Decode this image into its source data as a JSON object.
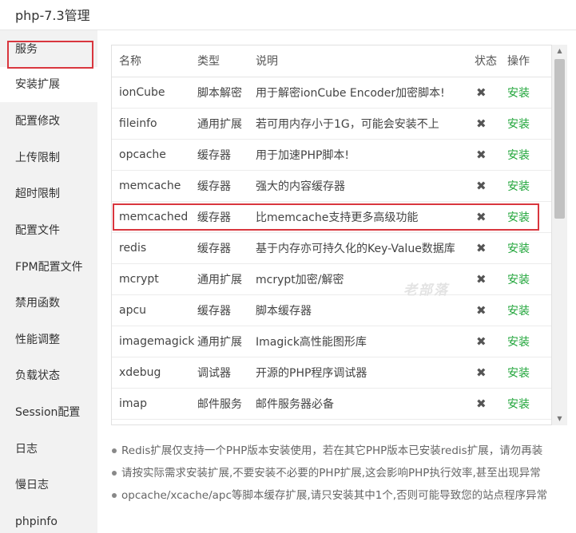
{
  "window": {
    "title": "php-7.3管理"
  },
  "sidebar": {
    "items": [
      {
        "label": "服务"
      },
      {
        "label": "安装扩展"
      },
      {
        "label": "配置修改"
      },
      {
        "label": "上传限制"
      },
      {
        "label": "超时限制"
      },
      {
        "label": "配置文件"
      },
      {
        "label": "FPM配置文件"
      },
      {
        "label": "禁用函数"
      },
      {
        "label": "性能调整"
      },
      {
        "label": "负载状态"
      },
      {
        "label": "Session配置"
      },
      {
        "label": "日志"
      },
      {
        "label": "慢日志"
      },
      {
        "label": "phpinfo"
      }
    ],
    "active_index": 1
  },
  "table": {
    "headers": {
      "name": "名称",
      "type": "类型",
      "desc": "说明",
      "status": "状态",
      "op": "操作"
    },
    "rows": [
      {
        "name": "ionCube",
        "type": "脚本解密",
        "desc": "用于解密ionCube Encoder加密脚本!",
        "status": "✖",
        "op": "安装"
      },
      {
        "name": "fileinfo",
        "type": "通用扩展",
        "desc": "若可用内存小于1G，可能会安装不上",
        "status": "✖",
        "op": "安装"
      },
      {
        "name": "opcache",
        "type": "缓存器",
        "desc": "用于加速PHP脚本!",
        "status": "✖",
        "op": "安装"
      },
      {
        "name": "memcache",
        "type": "缓存器",
        "desc": "强大的内容缓存器",
        "status": "✖",
        "op": "安装"
      },
      {
        "name": "memcached",
        "type": "缓存器",
        "desc": "比memcache支持更多高级功能",
        "status": "✖",
        "op": "安装"
      },
      {
        "name": "redis",
        "type": "缓存器",
        "desc": "基于内存亦可持久化的Key-Value数据库",
        "status": "✖",
        "op": "安装"
      },
      {
        "name": "mcrypt",
        "type": "通用扩展",
        "desc": "mcrypt加密/解密",
        "status": "✖",
        "op": "安装"
      },
      {
        "name": "apcu",
        "type": "缓存器",
        "desc": "脚本缓存器",
        "status": "✖",
        "op": "安装"
      },
      {
        "name": "imagemagick",
        "type": "通用扩展",
        "desc": "Imagick高性能图形库",
        "status": "✖",
        "op": "安装"
      },
      {
        "name": "xdebug",
        "type": "调试器",
        "desc": "开源的PHP程序调试器",
        "status": "✖",
        "op": "安装"
      },
      {
        "name": "imap",
        "type": "邮件服务",
        "desc": "邮件服务器必备",
        "status": "✖",
        "op": "安装"
      }
    ],
    "highlighted_row": "memcached"
  },
  "watermark": "老部落",
  "notes": [
    "Redis扩展仅支持一个PHP版本安装使用，若在其它PHP版本已安装redis扩展，请勿再装",
    "请按实际需求安装扩展,不要安装不必要的PHP扩展,这会影响PHP执行效率,甚至出现异常",
    "opcache/xcache/apc等脚本缓存扩展,请只安装其中1个,否则可能导致您的站点程序异常"
  ],
  "colors": {
    "install_link": "#20a53a",
    "highlight_border": "#d9363e",
    "sidebar_bg": "#f2f2f2"
  },
  "icons": {
    "status": "close-icon",
    "scroll_up": "chevron-up-icon",
    "scroll_down": "chevron-down-icon"
  }
}
